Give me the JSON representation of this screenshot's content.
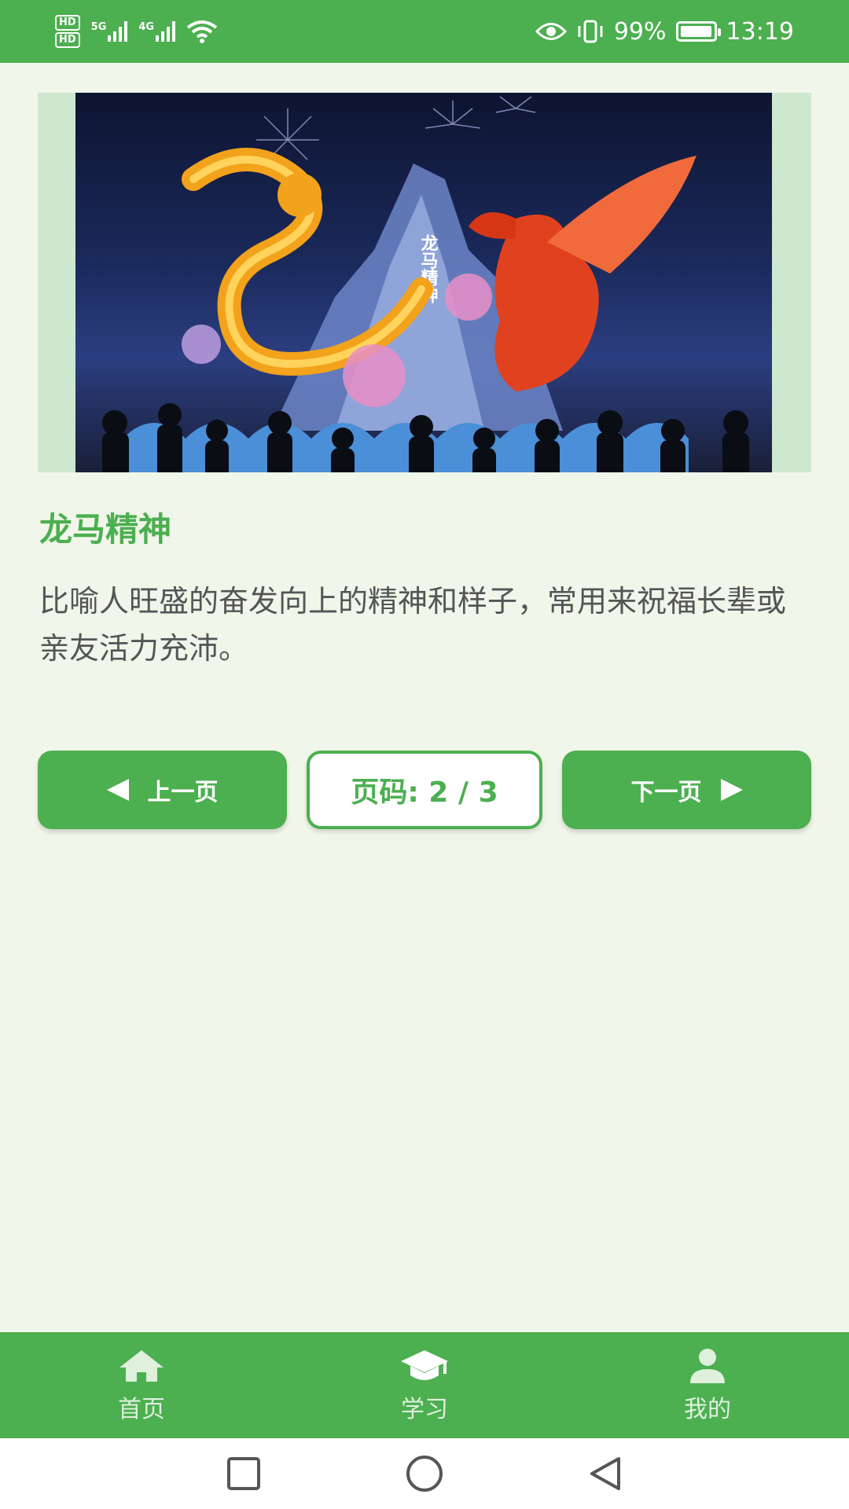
{
  "status_bar": {
    "hd1": "HD",
    "hd2": "HD",
    "net1": "5G",
    "net2": "4G",
    "battery_percent": "99%",
    "battery_level": 0.99,
    "time": "13:19"
  },
  "hero": {
    "sign_text": "龙马精神"
  },
  "content": {
    "title": "龙马精神",
    "description": "比喻人旺盛的奋发向上的精神和样子，常用来祝福长辈或亲友活力充沛。"
  },
  "pager": {
    "prev_label": "上一页",
    "next_label": "下一页",
    "page_text": "页码: 2 / 3"
  },
  "bottom_nav": {
    "items": [
      {
        "label": "首页",
        "icon": "home-icon"
      },
      {
        "label": "学习",
        "icon": "graduation-cap-icon"
      },
      {
        "label": "我的",
        "icon": "person-icon"
      }
    ]
  },
  "colors": {
    "primary": "#4caf50",
    "background": "#f1f6ea",
    "text": "#555555"
  }
}
